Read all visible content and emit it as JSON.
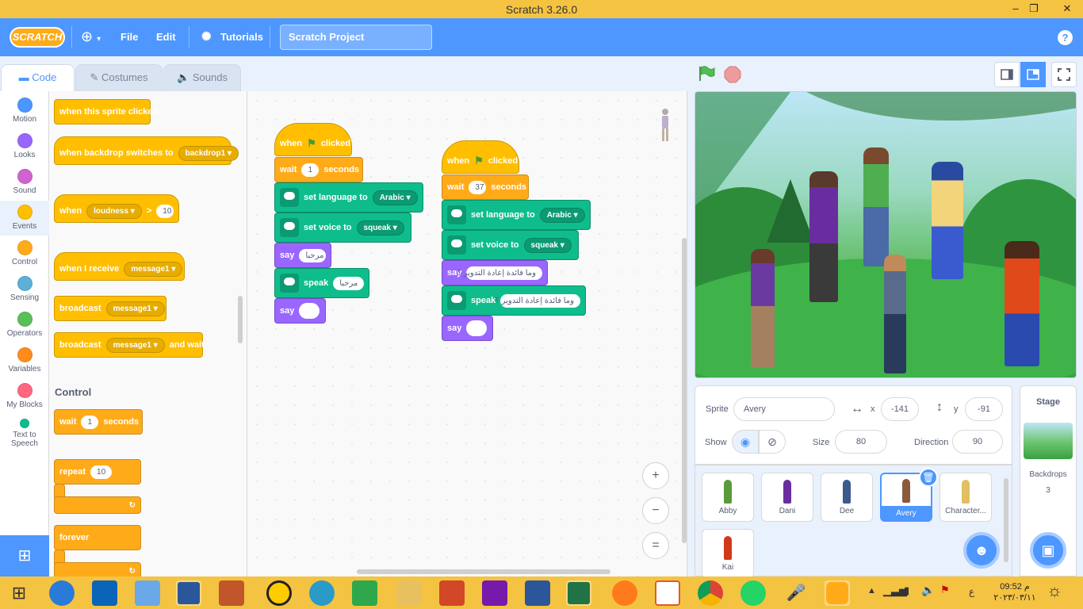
{
  "window": {
    "title": "Scratch 3.26.0",
    "controls": [
      "–",
      "❐",
      "✕"
    ]
  },
  "menubar": {
    "logo": "SCRATCH",
    "file": "File",
    "edit": "Edit",
    "tutorials": "Tutorials",
    "project_title": "Scratch Project",
    "help": "?"
  },
  "tabs": {
    "code": "Code",
    "costumes": "Costumes",
    "sounds": "Sounds"
  },
  "categories": [
    {
      "label": "Motion",
      "color": "#4c97ff"
    },
    {
      "label": "Looks",
      "color": "#9966ff"
    },
    {
      "label": "Sound",
      "color": "#cf63cf"
    },
    {
      "label": "Events",
      "color": "#ffbf00"
    },
    {
      "label": "Control",
      "color": "#ffab19"
    },
    {
      "label": "Sensing",
      "color": "#5cb1d6"
    },
    {
      "label": "Operators",
      "color": "#59c059"
    },
    {
      "label": "Variables",
      "color": "#ff8c1a"
    },
    {
      "label": "My Blocks",
      "color": "#ff6680"
    },
    {
      "label": "Text to Speech",
      "color": "#0fbd8c"
    }
  ],
  "palette": {
    "when_sprite_clicked": "when this sprite clicked",
    "when_backdrop": "when backdrop switches to",
    "backdrop1": "backdrop1",
    "when": "when",
    "loudness": "loudness",
    "gt": ">",
    "ten": "10",
    "when_receive": "when I receive",
    "message1": "message1",
    "broadcast": "broadcast",
    "and_wait": "and wait",
    "control_title": "Control",
    "wait": "wait",
    "one": "1",
    "seconds": "seconds",
    "repeat": "repeat",
    "forever": "forever"
  },
  "script1": {
    "when": "when",
    "clicked": "clicked",
    "wait": "wait",
    "wait_val": "1",
    "seconds": "seconds",
    "set_language": "set language to",
    "language": "Arabic",
    "set_voice": "set voice to",
    "voice": "squeak",
    "say": "say",
    "say_val": "مرحبا",
    "speak": "speak",
    "speak_val": "مرحبا",
    "say2": "say"
  },
  "script2": {
    "when": "when",
    "clicked": "clicked",
    "wait": "wait",
    "wait_val": "37",
    "seconds": "seconds",
    "set_language": "set language to",
    "language": "Arabic",
    "set_voice": "set voice to",
    "voice": "squeak",
    "say": "say",
    "say_val": "وما فائدة إعادة التدوير ؟",
    "speak": "speak",
    "speak_val": "وما فائدة إعادة التدوير ؟",
    "say2": "say"
  },
  "zoom": {
    "in": "+",
    "out": "−",
    "reset": "="
  },
  "sprite_info": {
    "sprite_label": "Sprite",
    "sprite_name": "Avery",
    "x_label": "x",
    "x": "-141",
    "y_label": "y",
    "y": "-91",
    "show_label": "Show",
    "size_label": "Size",
    "size": "80",
    "direction_label": "Direction",
    "direction": "90"
  },
  "sprites": [
    {
      "name": "Abby",
      "color": "#5a9a3c"
    },
    {
      "name": "Dani",
      "color": "#6a2da0"
    },
    {
      "name": "Dee",
      "color": "#3c5a8a"
    },
    {
      "name": "Avery",
      "color": "#8a5a3c",
      "selected": true
    },
    {
      "name": "Character...",
      "color": "#e0c060"
    },
    {
      "name": "Kai",
      "color": "#d03a1a"
    }
  ],
  "stage_pane": {
    "title": "Stage",
    "backdrops_label": "Backdrops",
    "backdrops_count": "3"
  },
  "taskbar": {
    "time": "09:52 م",
    "date": "٢٠٢٣/٠٣/١١",
    "lang": "ع"
  }
}
